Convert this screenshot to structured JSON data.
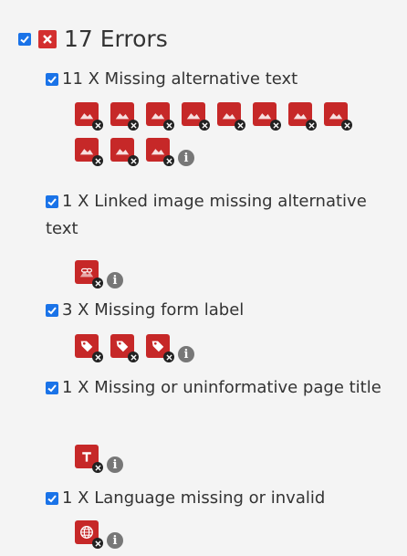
{
  "errors": {
    "title": "17 Errors",
    "colors": {
      "error": "#d32f2f",
      "checkbox": "#1a73e8",
      "info": "#777777"
    }
  },
  "categories": [
    {
      "label": "11 X Missing alternative text",
      "icon": "image-error-icon",
      "count": 11
    },
    {
      "label": "1 X Linked image missing alternative text",
      "icon": "linked-image-error-icon",
      "count": 1
    },
    {
      "label": "3 X Missing form label",
      "icon": "form-label-error-icon",
      "count": 3
    },
    {
      "label": "1 X Missing or uninformative page title",
      "icon": "page-title-error-icon",
      "count": 1
    },
    {
      "label": "1 X Language missing or invalid",
      "icon": "language-error-icon",
      "count": 1
    }
  ]
}
